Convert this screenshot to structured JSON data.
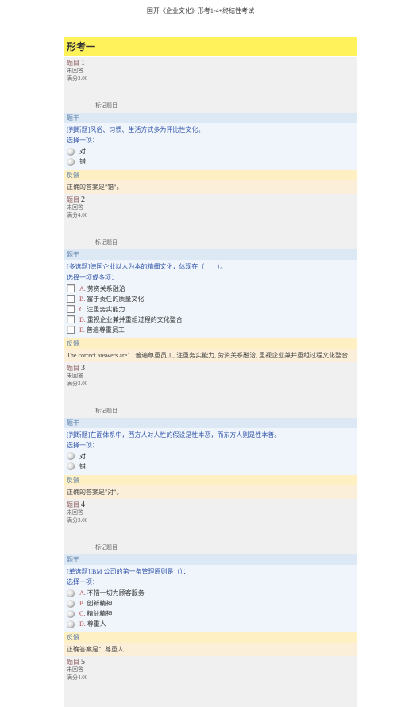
{
  "page_header": "国开《企业文化》形考1-4+终结性考试",
  "exam_title": "形考一",
  "labels": {
    "qprefix": "题目",
    "status": "未回答",
    "score_prefix": "满分",
    "flag": "标记题目",
    "stem": "题干",
    "feedback": "反馈",
    "select_one": "选择一项：",
    "select_multi": "选择一项或多项："
  },
  "q1": {
    "num": "1",
    "score": "3.00",
    "text": "[判断题]风俗、习惯、生活方式多为评比性文化。",
    "opt_true": "对",
    "opt_false": "错",
    "answer": "正确的答案是\"错\"。"
  },
  "q2": {
    "num": "2",
    "score": "4.00",
    "text": "[多选题]德国企业以人为本的精细文化，体现在（　　）。",
    "A": "劳资关系融洽",
    "B": "富于责任的质量文化",
    "C": "注重务实能力",
    "D": "重视企业兼并重组过程的文化整合",
    "E": "普遍尊重员工",
    "answer": "The correct answers are： 普遍尊重员工, 注重务实能力, 劳资关系融洽, 重视企业兼并重组过程文化整合"
  },
  "q3": {
    "num": "3",
    "score": "3.00",
    "text": "[判断题]在面体系中，西方人对人性的假设是性本恶，而东方人则是性本善。",
    "opt_true": "对",
    "opt_false": "错",
    "answer": "正确的答案是\"对\"。"
  },
  "q4": {
    "num": "4",
    "score": "3.00",
    "text": "[单选题]IBM 公司的第一条管理原则是（）：",
    "A": "不惜一切为顾客服务",
    "B": "创新精神",
    "C": "精益精神",
    "D": "尊重人",
    "answer": "正确答案是：尊重人"
  },
  "q5": {
    "num": "5",
    "score": "4.00"
  }
}
